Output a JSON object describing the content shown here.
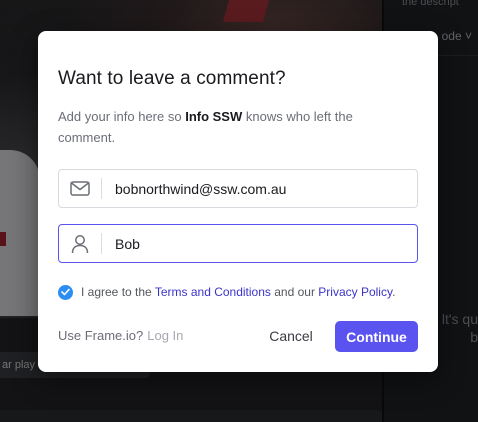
{
  "background": {
    "playbar_label": "ar play",
    "panel_top_text": "the descript",
    "panel_mode_text": "ode ˅",
    "panel_empty_lines": [
      "lt's qu",
      "b"
    ]
  },
  "modal": {
    "title": "Want to leave a comment?",
    "desc_prefix": "Add your info here so ",
    "desc_owner": "Info SSW",
    "desc_suffix": " knows who left the comment.",
    "email": {
      "icon": "mail-icon",
      "value": "bobnorthwind@ssw.com.au"
    },
    "name": {
      "icon": "user-icon",
      "value": "Bob"
    },
    "agree": {
      "checked": true,
      "prefix": "I agree to the ",
      "terms_link": "Terms and Conditions",
      "middle": " and our ",
      "privacy_link": "Privacy Policy",
      "suffix": "."
    },
    "footer": {
      "prompt": "Use Frame.io?",
      "login_link": "Log In",
      "cancel_label": "Cancel",
      "continue_label": "Continue"
    },
    "colors": {
      "accent": "#5b53f0",
      "checkbox": "#2c8df2",
      "link": "#3c34c9"
    }
  }
}
